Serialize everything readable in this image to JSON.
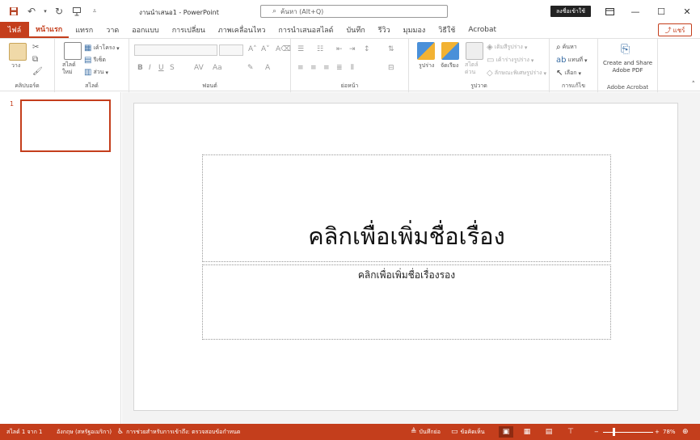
{
  "titlebar": {
    "document_title": "งานนำเสนอ1  -  PowerPoint",
    "search_placeholder": "ค้นหา (Alt+Q)",
    "signin_label": "ลงชื่อเข้าใช้"
  },
  "tabs": {
    "file": "ไฟล์",
    "items": [
      "หน้าแรก",
      "แทรก",
      "วาด",
      "ออกแบบ",
      "การเปลี่ยน",
      "ภาพเคลื่อนไหว",
      "การนำเสนอสไลด์",
      "บันทึก",
      "รีวิว",
      "มุมมอง",
      "วิธีใช้",
      "Acrobat"
    ],
    "share_label": "แชร์"
  },
  "ribbon": {
    "clipboard": {
      "label": "คลิปบอร์ด",
      "paste": "วาง"
    },
    "slides": {
      "label": "สไลด์",
      "new_slide": "สไลด์ใหม่",
      "layout": "เค้าโครง",
      "reset": "รีเซ็ต",
      "section": "ส่วน"
    },
    "font": {
      "label": "ฟอนต์"
    },
    "paragraph": {
      "label": "ย่อหน้า"
    },
    "drawing": {
      "label": "รูปวาด",
      "shapes": "รูปร่าง",
      "arrange": "จัดเรียง",
      "quick_styles": "สไตล์ด่วน",
      "fill": "เติมสีรูปร่าง",
      "outline": "เค้าร่างรูปร่าง",
      "effects": "ลักษณะพิเศษรูปร่าง"
    },
    "editing": {
      "label": "การแก้ไข",
      "find": "ค้นหา",
      "replace": "แทนที่",
      "select": "เลือก"
    },
    "acrobat": {
      "label": "Adobe Acrobat",
      "create_share_line1": "Create and Share",
      "create_share_line2": "Adobe PDF"
    }
  },
  "thumbnails": {
    "slide_number": "1"
  },
  "slide": {
    "title_placeholder": "คลิกเพื่อเพิ่มชื่อเรื่อง",
    "subtitle_placeholder": "คลิกเพื่อเพิ่มชื่อเรื่องรอง"
  },
  "statusbar": {
    "slide_info": "สไลด์ 1 จาก 1",
    "language": "อังกฤษ (สหรัฐอเมริกา)",
    "accessibility": "การช่วยสำหรับการเข้าถึง: ตรวจสอบข้อกำหนด",
    "notes": "บันทึกย่อ",
    "comments": "ข้อคิดเห็น",
    "zoom": "78%"
  },
  "colors": {
    "accent": "#c43e1c"
  }
}
